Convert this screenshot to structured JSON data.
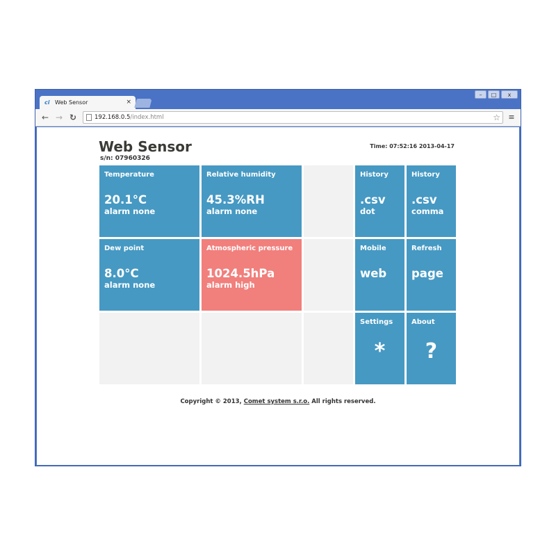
{
  "browser": {
    "tab_title": "Web Sensor",
    "tab_close": "×",
    "favicon": "ci",
    "url_host": "192.168.0.5",
    "url_path": "/index.html",
    "window_buttons": {
      "minimize": "–",
      "maximize": "□",
      "close": "x"
    }
  },
  "page": {
    "title": "Web Sensor",
    "serial": "s/n: 07960326",
    "time": "Time: 07:52:16 2013-04-17"
  },
  "tiles": {
    "temperature": {
      "label": "Temperature",
      "value": "20.1°C",
      "status": "alarm none"
    },
    "humidity": {
      "label": "Relative humidity",
      "value": "45.3%RH",
      "status": "alarm none"
    },
    "dew_point": {
      "label": "Dew point",
      "value": "8.0°C",
      "status": "alarm none"
    },
    "pressure": {
      "label": "Atmospheric pressure",
      "value": "1024.5hPa",
      "status": "alarm high"
    },
    "history_dot": {
      "label": "History",
      "value": ".csv",
      "status": "dot"
    },
    "history_comma": {
      "label": "History",
      "value": ".csv",
      "status": "comma"
    },
    "mobile": {
      "label": "Mobile",
      "value": "web"
    },
    "refresh": {
      "label": "Refresh",
      "value": "page"
    },
    "settings": {
      "label": "Settings",
      "symbol": "*"
    },
    "about": {
      "label": "About",
      "symbol": "?"
    }
  },
  "footer": {
    "prefix": "Copyright © 2013, ",
    "link": "Comet system s.r.o.",
    "suffix": " All rights reserved."
  },
  "colors": {
    "tile_blue": "#4699c3",
    "tile_alarm": "#f17f7c",
    "tile_empty": "#f2f2f2",
    "window_frame": "#4a73c6"
  }
}
